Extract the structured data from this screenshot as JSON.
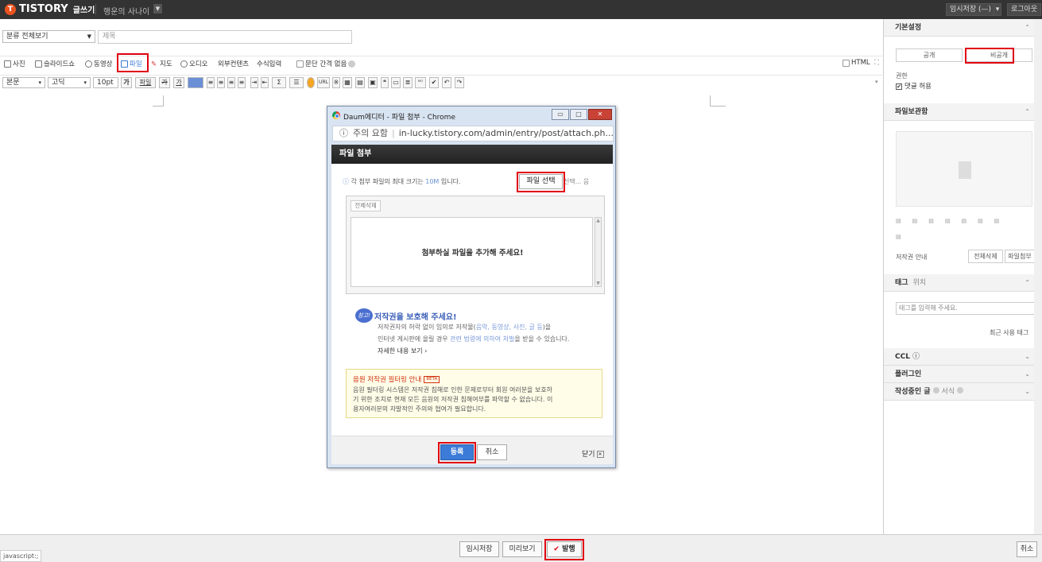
{
  "topbar": {
    "logo": "TISTORY",
    "logo_sub": "글쓰기",
    "blog_name": "행운의 사나이",
    "draft_button": "임시저장 (—)",
    "logout_button": "로그아웃"
  },
  "editor": {
    "category_select": "분류 전체보기",
    "title_placeholder": "제목",
    "attach": {
      "photo": "사진",
      "slideshow": "슬라이드쇼",
      "video": "동영상",
      "file": "파일",
      "map": "지도",
      "audio": "오디오",
      "external": "외부컨텐츠",
      "formula": "수식입력",
      "no_spacing": "문단 간격 없음",
      "html": "HTML"
    },
    "format": {
      "style": "본문",
      "font": "고딕",
      "size": "10pt",
      "bold": "가",
      "active": "파일",
      "strike": "가",
      "underline": "가"
    }
  },
  "dialog": {
    "window_title": "Daum에디터 - 파일 첨부 - Chrome",
    "url_warning": "주의 요함",
    "url": "in-lucky.tistory.com/admin/entry/post/attach.ph...",
    "header": "파일 첨부",
    "limit_note_prefix": "각 첨부 파일의 최대 크기는",
    "limit_value": "10M",
    "limit_note_suffix": "입니다.",
    "pick_button": "파일 선택",
    "pick_extra": "선택... 음",
    "delete_all": "전체삭제",
    "empty_message": "첨부하실 파일을 추가해 주세요!",
    "copyright_badge": "참고!",
    "copyright_title": "저작권을 보호해 주세요!",
    "copyright_line1_a": "저작권자의 허락 없이 임의로 저작물(",
    "copyright_line1_b": "음악, 동영상, 사진, 글 등",
    "copyright_line1_c": ")을",
    "copyright_line2_a": "인터넷 게시판에 올릴 경우",
    "copyright_line2_b": "관련 법령에 의하여 처벌",
    "copyright_line2_c": "을 받을 수 있습니다.",
    "copyright_more": "자세한 내용 보기 ›",
    "music_title": "음원 저작권 필터링 안내",
    "music_beta": "BETA",
    "music_line1": "음원 필터링 시스템은 저작권 침해로 인한 문제로부터 회원 여러분을 보호하",
    "music_line2": "기 위한 조치로 현재 모든 음원의 저작권 침해여부를 파악할 수 없습니다. 이",
    "music_line3": "용자여러분의 자발적인 주의와 협여가 필요합니다.",
    "register_button": "등록",
    "cancel_button": "취소",
    "close_link": "닫기"
  },
  "sidebar": {
    "basic_settings": "기본설정",
    "public": "공개",
    "private": "비공개",
    "permission": "권한",
    "allow_comments": "댓글 허용",
    "file_storage": "파일보관함",
    "copyright_info": "저작권 안내",
    "delete_all": "전체삭제",
    "attach_file": "파일첨부",
    "tags": "태그",
    "location": "위치",
    "tag_placeholder": "태그를 입력해 주세요.",
    "recent_tags": "최근 사용 태그",
    "ccl": "CCL",
    "plugins": "플러그인",
    "drafts": "작성중인 글",
    "format": "서식"
  },
  "footer": {
    "save_draft": "임시저장",
    "preview": "미리보기",
    "publish": "발행",
    "cancel": "취소",
    "status": "javascript:;"
  },
  "colors": {
    "highlight": "#e0000f",
    "primary_blue": "#3c7bd7",
    "brand_orange": "#eb531f"
  }
}
